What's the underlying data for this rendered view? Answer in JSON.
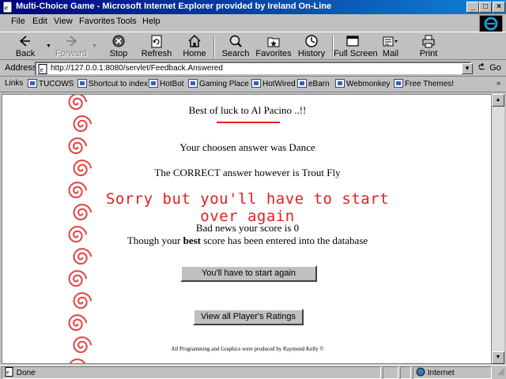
{
  "window": {
    "title": "Multi-Choice Game - Microsoft Internet Explorer provided by Ireland On-Line",
    "controls": {
      "minimize": "_",
      "maximize": "□",
      "close": "×"
    }
  },
  "menu": [
    "File",
    "Edit",
    "View",
    "Favorites",
    "Tools",
    "Help"
  ],
  "toolbar": {
    "back": "Back",
    "forward": "Forward",
    "stop": "Stop",
    "refresh": "Refresh",
    "home": "Home",
    "search": "Search",
    "favorites": "Favorites",
    "history": "History",
    "fullscreen": "Full Screen",
    "mail": "Mail",
    "print": "Print"
  },
  "address": {
    "label": "Address",
    "url": "http://127.0.0.1:8080/servlet/Feedback.Answered",
    "go": "Go"
  },
  "links": {
    "label": "Links",
    "items": [
      "TUCOWS",
      "Shortcut to index",
      "HotBot",
      "Gaming Place",
      "HotWired",
      "eBarn",
      "Webmonkey",
      "Free Themes!"
    ]
  },
  "page": {
    "greeting": "Best of luck to Al Pacino ..!!",
    "chosen": "Your choosen answer was Dance",
    "correct": "The CORRECT answer however is Trout Fly",
    "sorry": "Sorry but you'll have to start over again",
    "score": "Bad news your score is 0",
    "best_prefix": "Though your ",
    "best_word": "best",
    "best_suffix": " score has been entered into the database",
    "start_again_button": "You'll have to start again",
    "ratings_button": "View all Player's Ratings",
    "credits": "All Programming and Graphics were produced by Raymond Kelly ©"
  },
  "status": {
    "text": "Done",
    "zone": "Internet"
  },
  "colors": {
    "titlebar": "#000080",
    "accent_red": "#e02020",
    "chrome": "#c0c0c0"
  }
}
